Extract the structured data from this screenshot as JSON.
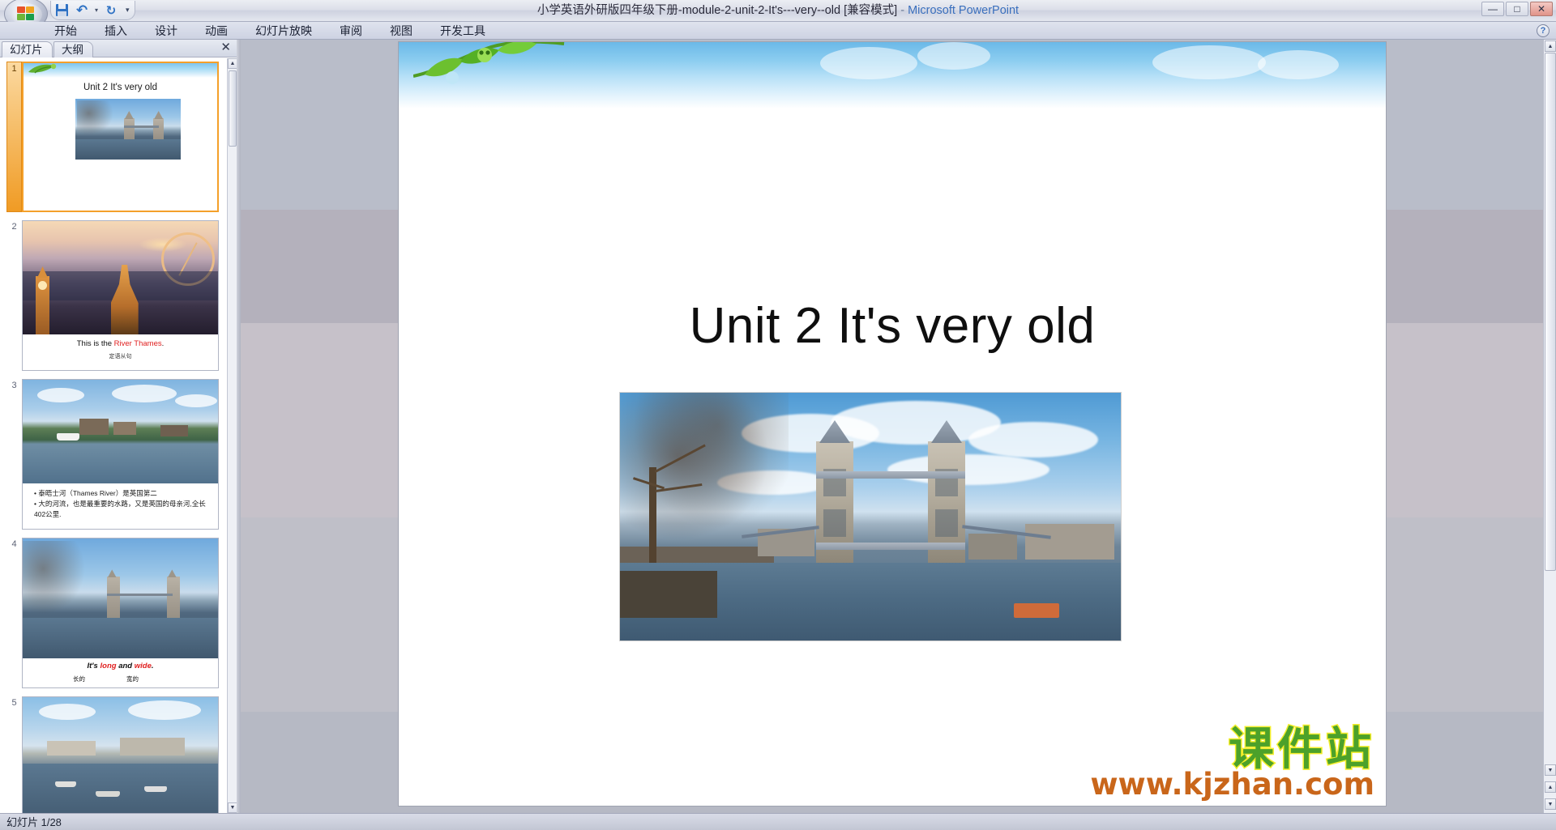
{
  "window": {
    "title": "小学英语外研版四年级下册-module-2-unit-2-It's---very--old [兼容模式]",
    "dash": "-",
    "app_name": "Microsoft PowerPoint",
    "minimize": "—",
    "maximize": "□",
    "close": "✕"
  },
  "quick_access": {
    "save_label": "保存",
    "undo_label": "撤消",
    "undo_dropdown": "▾",
    "redo_label": "恢复",
    "customize": "▾"
  },
  "ribbon": {
    "tabs": [
      {
        "label": "开始"
      },
      {
        "label": "插入"
      },
      {
        "label": "设计"
      },
      {
        "label": "动画"
      },
      {
        "label": "幻灯片放映"
      },
      {
        "label": "审阅"
      },
      {
        "label": "视图"
      },
      {
        "label": "开发工具"
      }
    ],
    "help": "?"
  },
  "left_pane": {
    "tabs": [
      {
        "label": "幻灯片"
      },
      {
        "label": "大纲"
      }
    ],
    "close": "✕",
    "scroll_up": "▲",
    "scroll_down": "▼",
    "slides": [
      {
        "number": "1",
        "selected": true,
        "title": "Unit 2 It's   very  old"
      },
      {
        "number": "2",
        "selected": false,
        "caption_plain": "This is the ",
        "caption_red": "River Thames",
        "caption_end": ".",
        "caption_sub": "定语从句"
      },
      {
        "number": "3",
        "selected": false,
        "bullets": [
          "泰晤士河（Thames River）是英国第二",
          "大的河流，也是最重要的水路，又是英国的母亲河,全长402公里."
        ],
        "links": [
          "英国",
          "河流",
          "母亲河"
        ]
      },
      {
        "number": "4",
        "selected": false,
        "caption_prefix": "It's ",
        "caption_w1": "long",
        "caption_mid": " and ",
        "caption_w2": "wide",
        "caption_end": ".",
        "sub_left": "长的",
        "sub_right": "宽的"
      },
      {
        "number": "5",
        "selected": false
      }
    ]
  },
  "slide": {
    "title": "Unit 2 It's   very  old",
    "watermark_cn": "课件站",
    "watermark_url": "www.kjzhan.com"
  },
  "canvas_scroll": {
    "up": "▲",
    "down": "▼",
    "prev_slide": "▲",
    "next_slide": "▼"
  },
  "status": {
    "text": "幻灯片 1/28"
  },
  "colors": {
    "selection_orange": "#f4a02a",
    "link_blue": "#3a78c8",
    "accent_red": "#e02020",
    "title_blue": "#3a6fbd",
    "watermark_green": "#4ca12a",
    "watermark_yellow": "#f4ee2a",
    "watermark_orange": "#c9661a"
  }
}
